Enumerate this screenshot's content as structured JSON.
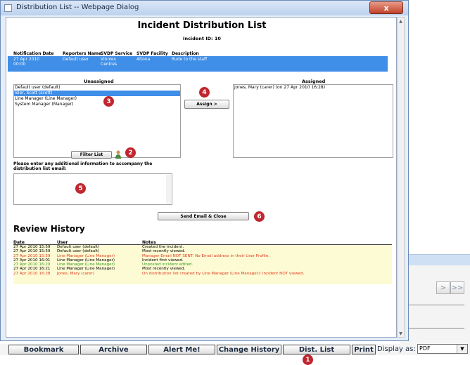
{
  "dialog": {
    "title": "Distribution List -- Webpage Dialog",
    "close_label": "x"
  },
  "page": {
    "title": "Incident Distribution List",
    "incident_id": "Incident ID: 10"
  },
  "incident_table": {
    "headers": [
      "Notification Date",
      "Reporters Name",
      "SVDP Service",
      "SVDP Facility",
      "Description"
    ],
    "row": {
      "date_line1": "27 Apr 2010",
      "date_line2": "00:00",
      "reporter": "Default user",
      "service_line1": "Vinnies",
      "service_line2": "Centres",
      "facility": "Altona",
      "description": "Rude to the staff"
    }
  },
  "unassigned": {
    "label": "Unassigned",
    "items": [
      "Default user (default)",
      "Isler, Scott (scott)",
      "Line Manager (Line Manager)",
      "System Manager (Manager)"
    ],
    "selected_index": 1
  },
  "assigned": {
    "label": "Assigned",
    "items": [
      "Jones, Mary (carer) (on 27 Apr 2010 16:28)"
    ]
  },
  "buttons": {
    "assign": "Assign >",
    "filter": "Filter List",
    "send": "Send Email & Close"
  },
  "email_prompt": {
    "line1": "Please enter any additional information to accompany the",
    "line2": "distribution list email:",
    "value": ""
  },
  "badges": [
    "1",
    "2",
    "3",
    "4",
    "5",
    "6"
  ],
  "review": {
    "title": "Review History",
    "headers": [
      "Date",
      "User",
      "Notes"
    ],
    "rows": [
      {
        "date": "27 Apr 2010 15:59",
        "user": "Default user (default)",
        "note": "Created the incident.",
        "color": "#000000"
      },
      {
        "date": "27 Apr 2010 15:59",
        "user": "Default user (default)",
        "note": "Most recently viewed.",
        "color": "#000000"
      },
      {
        "date": "27 Apr 2010 15:59",
        "user": "Line Manager (Line Manager)",
        "note": "Manager Email NOT SENT: No Email address in their User Profile.",
        "color": "#e03a1e"
      },
      {
        "date": "27 Apr 2010 16:01",
        "user": "Line Manager (Line Manager)",
        "note": "Incident first viewed.",
        "color": "#000000"
      },
      {
        "date": "27 Apr 2010 16:20",
        "user": "Line Manager (Line Manager)",
        "note": "Unposted incident edited.",
        "color": "#3a9a1e"
      },
      {
        "date": "27 Apr 2010 16:21",
        "user": "Line Manager (Line Manager)",
        "note": "Most recently viewed.",
        "color": "#000000"
      },
      {
        "date": "27 Apr 2010 16:28",
        "user": "Jones, Mary (carer)",
        "note": "On distribution list created by Line Manager (Line Manager): Incident NOT viewed.",
        "color": "#e03a1e"
      }
    ]
  },
  "toolbar": {
    "bookmark": "Bookmark",
    "archive": "Archive",
    "alert": "Alert Me!",
    "history": "Change History",
    "dist_list": "Dist. List",
    "print": "Print",
    "display_as": "Display as:",
    "format": "PDF"
  },
  "background_nav": {
    "next": ">",
    "last": ">>"
  },
  "colors": {
    "selection": "#3f8ee8",
    "badge": "#c0262e",
    "history_bg": "#fdfbd4"
  }
}
